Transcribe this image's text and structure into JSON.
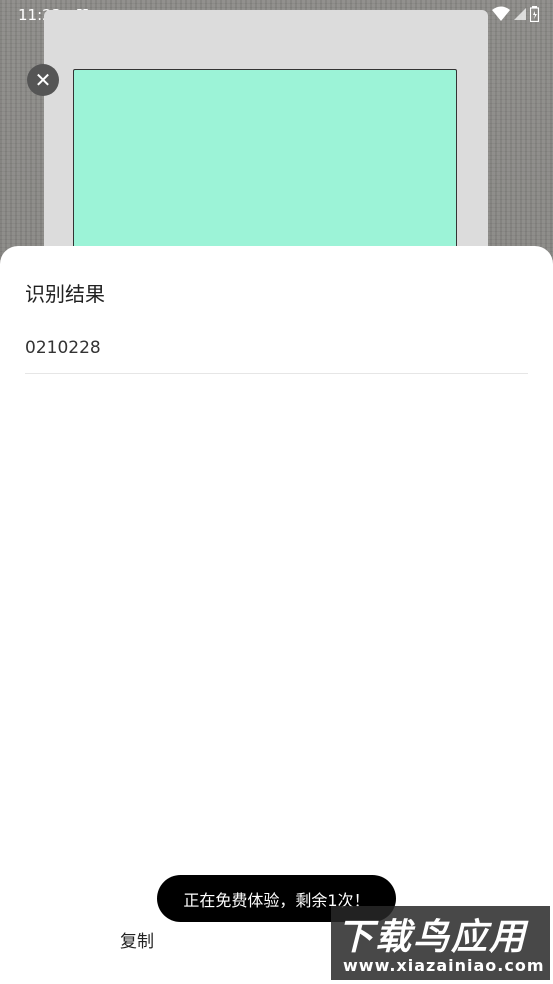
{
  "status_bar": {
    "time": "11:23",
    "app_badge": "A"
  },
  "close_icon_glyph": "✕",
  "result_sheet": {
    "title": "识别结果",
    "result_value": "0210228",
    "copy_label": "复制"
  },
  "toast": {
    "message": "正在免费体验，剩余1次！"
  },
  "watermark": {
    "main": "下载鸟应用",
    "sub": "www.xiazainiao.com"
  },
  "colors": {
    "card_green": "#9cf3d7",
    "toast_bg": "#000000",
    "sheet_bg": "#ffffff"
  }
}
